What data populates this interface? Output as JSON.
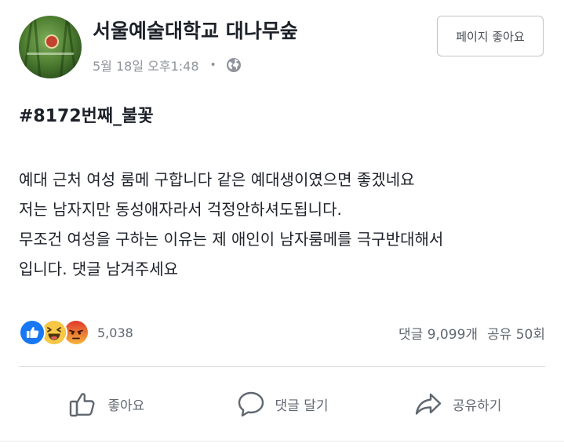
{
  "post": {
    "page_name": "서울예술대학교 대나무숲",
    "timestamp": "5월 18일 오후1:48",
    "separator": "•",
    "like_page_label": "페이지 좋아요",
    "hashtag": "#8172번째_불꽃",
    "body_lines": [
      "예대 근처 여성 룸메 구합니다  같은 예대생이였으면 좋겠네요",
      "저는 남자지만 동성애자라서 걱정안하셔도됩니다.",
      "무조건 여성을 구하는 이유는 제 애인이 남자룸메를 극구반대해서",
      "입니다.  댓글 남겨주세요"
    ],
    "reaction_icons": [
      "like-icon",
      "haha-icon",
      "angry-icon"
    ],
    "reaction_count": "5,038",
    "comments": "댓글 9,099개",
    "shares": "공유 50회"
  },
  "actions": {
    "like": "좋아요",
    "comment": "댓글 달기",
    "share": "공유하기"
  },
  "colors": {
    "like_blue": "#1877f2",
    "haha_yellow": "#f7c745",
    "angry_orange": "#e9710f",
    "muted_text": "#606770"
  }
}
